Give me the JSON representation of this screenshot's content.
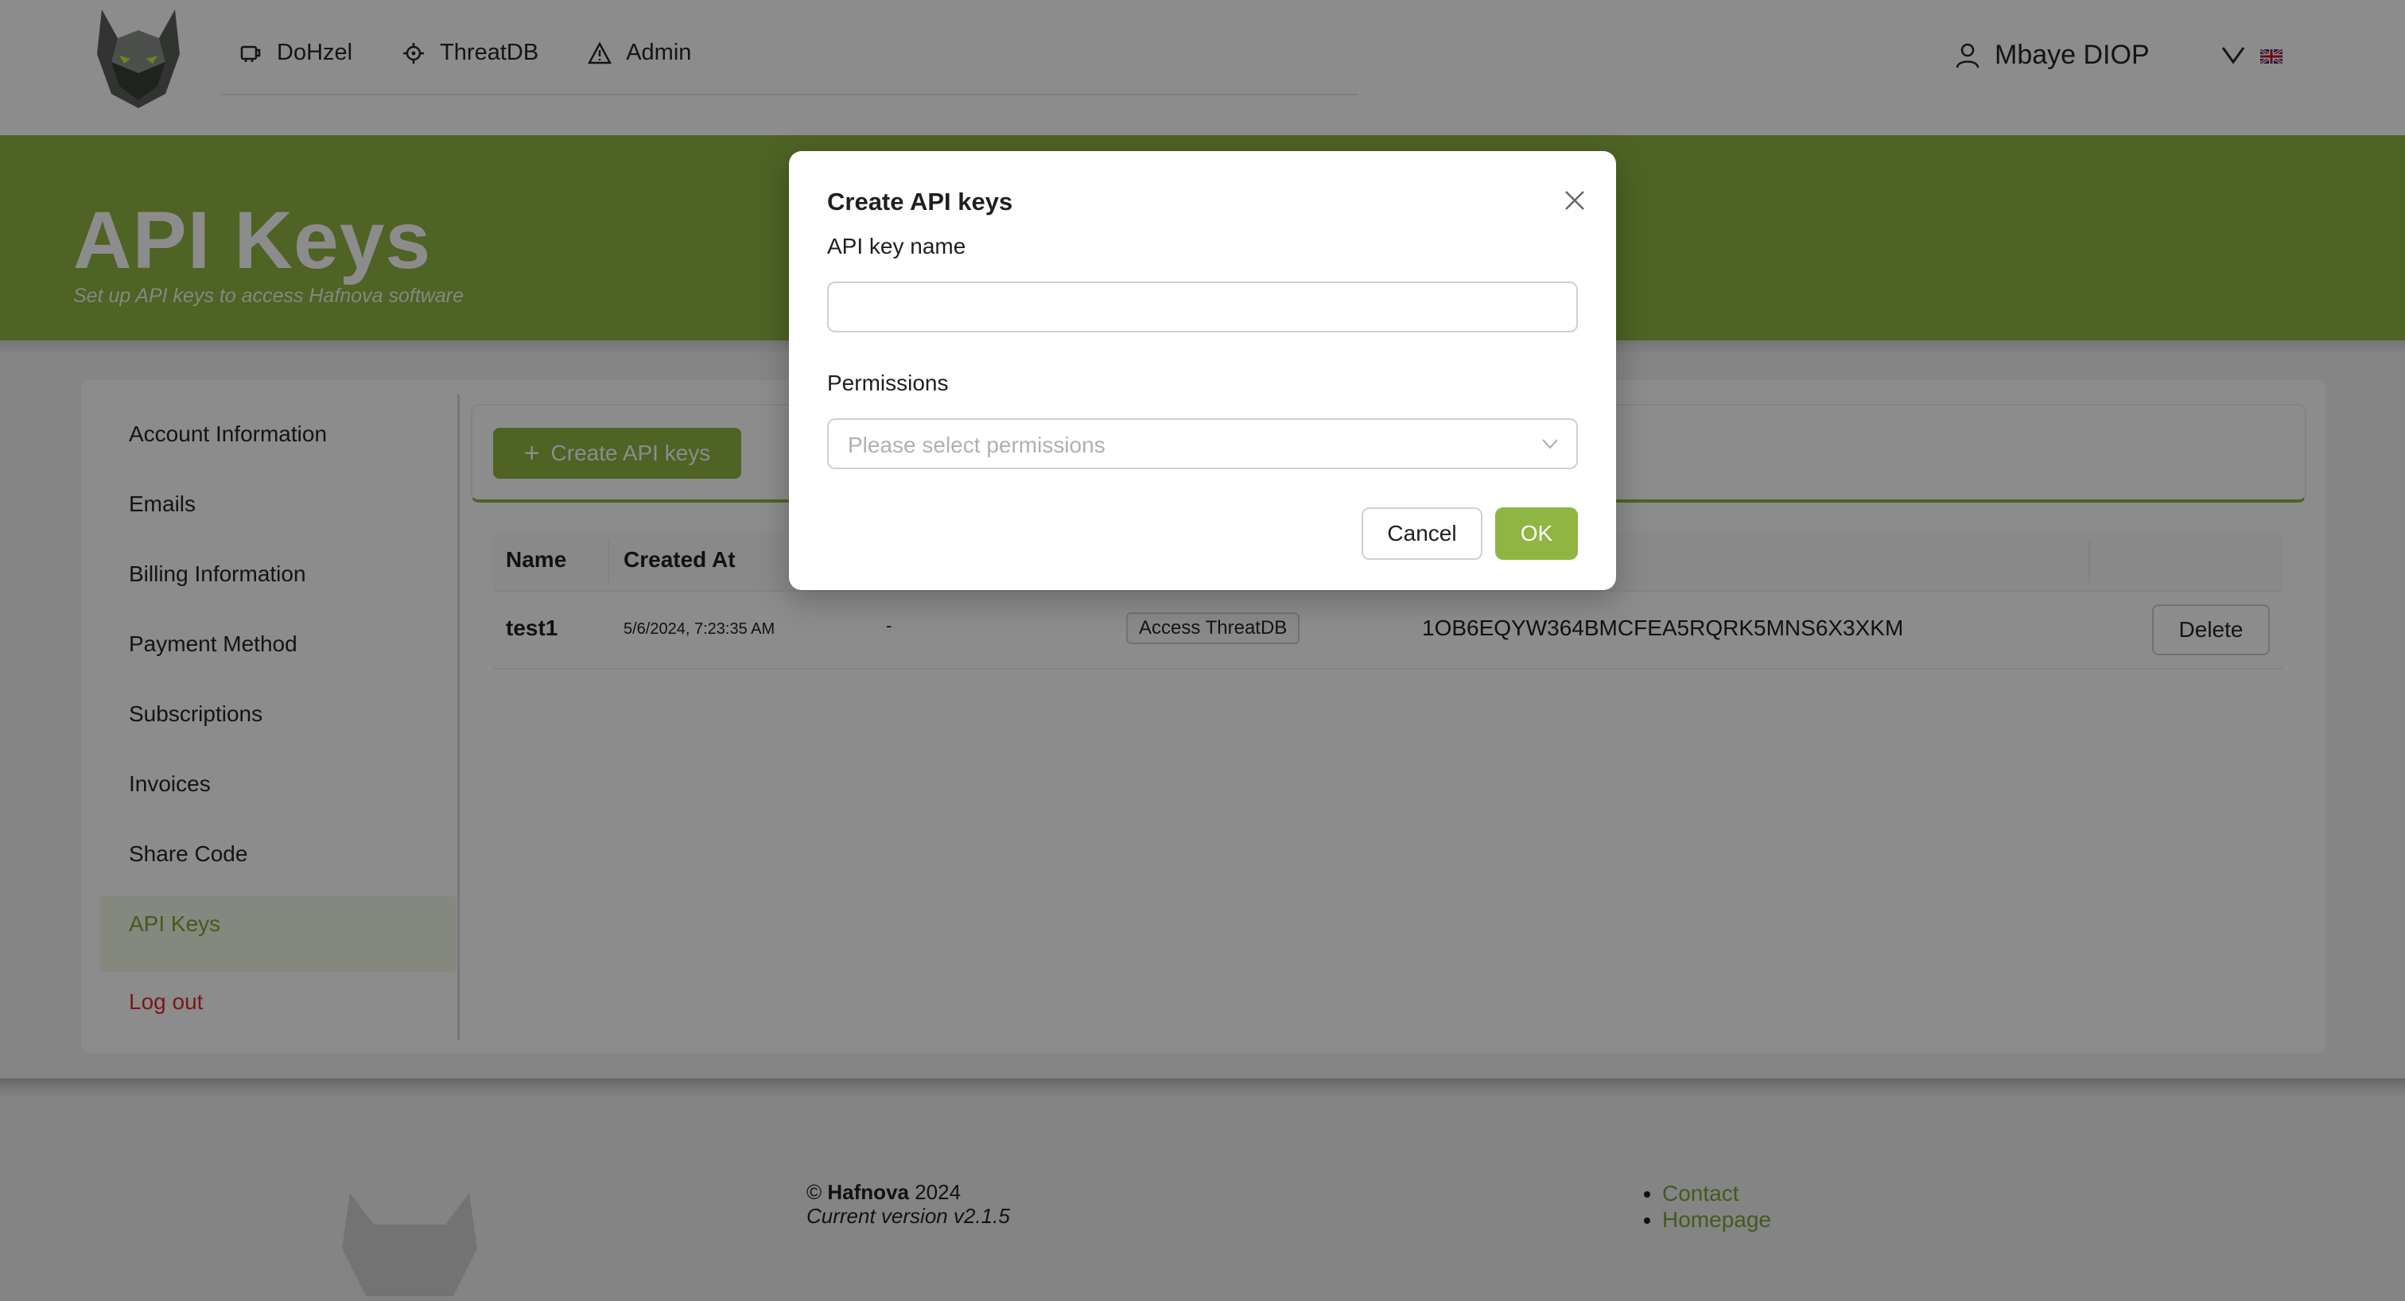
{
  "header": {
    "nav": [
      {
        "label": "DoHzel",
        "icon": "dohzel-icon"
      },
      {
        "label": "ThreatDB",
        "icon": "crosshair-icon"
      },
      {
        "label": "Admin",
        "icon": "warning-triangle-icon"
      }
    ],
    "user_name": "Mbaye DIOP",
    "language_flag": "uk-flag-icon"
  },
  "banner": {
    "title": "API Keys",
    "subtitle": "Set up API keys to access Hafnova software"
  },
  "sidebar": {
    "items": [
      {
        "label": "Account Information"
      },
      {
        "label": "Emails"
      },
      {
        "label": "Billing Information"
      },
      {
        "label": "Payment Method"
      },
      {
        "label": "Subscriptions"
      },
      {
        "label": "Invoices"
      },
      {
        "label": "Share Code"
      },
      {
        "label": "API Keys"
      }
    ],
    "logout_label": "Log out"
  },
  "toolbar": {
    "create_label": "Create API keys"
  },
  "table": {
    "columns": [
      "Name",
      "Created At"
    ],
    "rows": [
      {
        "name": "test1",
        "created_at": "5/6/2024, 7:23:35 AM",
        "expires": "-",
        "permission": "Access ThreatDB",
        "key": "1OB6EQYW364BMCFEA5RQRK5MNS6X3XKM",
        "delete_label": "Delete"
      }
    ]
  },
  "footer": {
    "copyright_symbol": "©",
    "company": "Hafnova",
    "year": "2024",
    "version": "Current version v2.1.5",
    "links": [
      "Contact",
      "Homepage"
    ]
  },
  "modal": {
    "title": "Create API keys",
    "name_label": "API key name",
    "name_value": "",
    "permissions_label": "Permissions",
    "permissions_placeholder": "Please select permissions",
    "cancel_label": "Cancel",
    "ok_label": "OK"
  },
  "colors": {
    "brand_green": "#8fb543",
    "active_text": "#7da536",
    "logout_red": "#e0282e"
  }
}
